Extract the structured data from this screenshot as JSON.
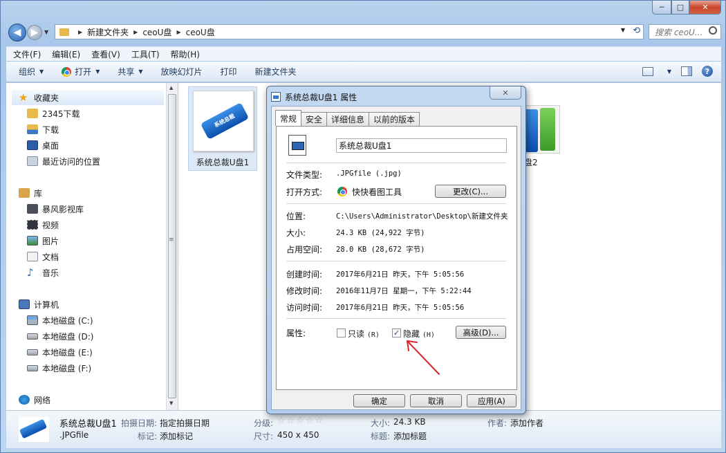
{
  "window": {
    "maximize_glyph": "□",
    "close_glyph": "✕",
    "minimize_glyph": "─"
  },
  "address": {
    "crumbs": [
      "新建文件夹",
      "ceoU盘",
      "ceoU盘"
    ],
    "search_placeholder": "搜索 ceoU..."
  },
  "menubar": [
    "文件(F)",
    "编辑(E)",
    "查看(V)",
    "工具(T)",
    "帮助(H)"
  ],
  "toolbar": {
    "organize": "组织",
    "open": "打开",
    "share": "共享",
    "slideshow": "放映幻灯片",
    "print": "打印",
    "new_folder": "新建文件夹"
  },
  "navpane": {
    "favorites": "收藏夹",
    "fav_items": [
      "2345下载",
      "下载",
      "桌面",
      "最近访问的位置"
    ],
    "libraries": "库",
    "lib_items": [
      "暴风影视库",
      "视频",
      "图片",
      "文档",
      "音乐"
    ],
    "computer": "计算机",
    "drives": [
      "本地磁盘 (C:)",
      "本地磁盘 (D:)",
      "本地磁盘 (E:)",
      "本地磁盘 (F:)"
    ],
    "network": "网络"
  },
  "files": [
    {
      "name": "系统总裁U盘1"
    },
    {
      "name": "盘2"
    }
  ],
  "details": {
    "name": "系统总裁U盘1",
    "type": ".JPGfile",
    "date_taken_label": "拍摄日期:",
    "date_taken": "指定拍摄日期",
    "tags_label": "标记:",
    "tags": "添加标记",
    "rating_label": "分级:",
    "dimensions_label": "尺寸:",
    "dimensions": "450 x 450",
    "size_label": "大小:",
    "size": "24.3 KB",
    "title_label": "标题:",
    "title": "添加标题",
    "author_label": "作者:",
    "author": "添加作者"
  },
  "dialog": {
    "title": "系统总裁U盘1 属性",
    "tabs": [
      "常规",
      "安全",
      "详细信息",
      "以前的版本"
    ],
    "filename": "系统总裁U盘1",
    "file_type_label": "文件类型:",
    "file_type": ".JPGfile (.jpg)",
    "open_with_label": "打开方式:",
    "open_with": "快快看图工具",
    "change_button": "更改(C)...",
    "location_label": "位置:",
    "location": "C:\\Users\\Administrator\\Desktop\\新建文件夹",
    "size_label": "大小:",
    "size": "24.3 KB (24,922 字节)",
    "disk_size_label": "占用空间:",
    "disk_size": "28.0 KB (28,672 字节)",
    "created_label": "创建时间:",
    "created": "2017年6月21日 昨天，下午 5:05:56",
    "modified_label": "修改时间:",
    "modified": "2016年11月7日 星期一，下午 5:22:44",
    "accessed_label": "访问时间:",
    "accessed": "2017年6月21日 昨天，下午 5:05:56",
    "attributes_label": "属性:",
    "readonly_label": "只读",
    "readonly_key": "(R)",
    "readonly_checked": false,
    "hidden_label": "隐藏",
    "hidden_key": "(H)",
    "hidden_checked": true,
    "advanced_button": "高级(D)...",
    "ok_button": "确定",
    "cancel_button": "取消",
    "apply_button": "应用(A)"
  },
  "colors": {
    "annotation_arrow": "#d8242b",
    "accent": "#2b5797"
  }
}
